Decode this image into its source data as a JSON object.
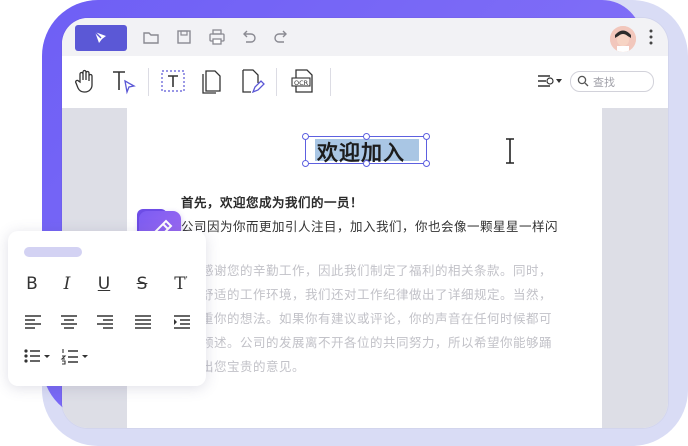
{
  "document": {
    "title": "欢迎加入",
    "paragraphs": [
      "首先，欢迎您成为我们的一员！",
      "公司因为你而更加引人注目，加入我们，你也会像一颗星星一样闪",
      "感谢您的辛勤工作，因此我们制定了福利的相关条款。同时，",
      "舒适的工作环境，我们还对工作纪律做出了详细规定。当然，",
      "重你的想法。如果你有建议或评论，你的声音在任何时候都可",
      "领述。公司的发展离不开各位的共同努力，所以希望你能够踊",
      "出您宝贵的意见。"
    ]
  },
  "toolbar": {
    "search_placeholder": "查找"
  },
  "format_panel": {
    "bold_label": "B",
    "italic_label": "I",
    "underline_label": "U",
    "strike_label": "S",
    "superscript_label": "T"
  },
  "icons": [
    "pen-logo-icon",
    "folder-icon",
    "save-icon",
    "print-icon",
    "undo-icon",
    "redo-icon",
    "hand-tool-icon",
    "text-select-icon",
    "text-edit-icon",
    "pages-icon",
    "edit-document-icon",
    "ocr-icon",
    "view-mode-icon",
    "search-icon",
    "more-icon",
    "pencil-icon"
  ],
  "colors": {
    "accent": "#5b58d6",
    "frame": "#7a66f6",
    "selection": "#a9c6e4"
  }
}
